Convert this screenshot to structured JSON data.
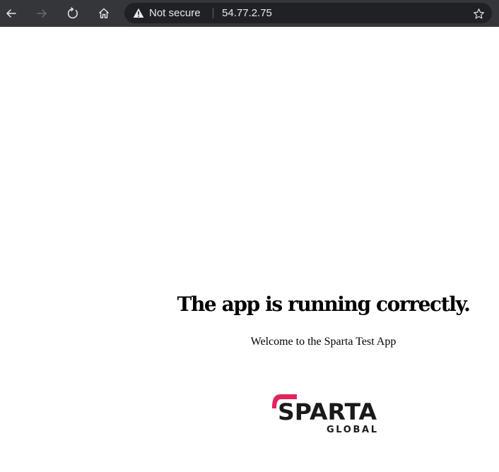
{
  "browser": {
    "security_label": "Not secure",
    "url": "54.77.2.75",
    "icons": {
      "back": "back-arrow-icon",
      "forward": "forward-arrow-icon",
      "reload": "reload-icon",
      "home": "home-icon",
      "warning": "warning-triangle-icon",
      "bookmark": "star-icon"
    }
  },
  "page": {
    "heading": "The app is running correctly.",
    "welcome": "Welcome to the Sparta Test App",
    "logo": {
      "line1": "SPARTA",
      "line2": "GLOBAL",
      "accent_color": "#e0245e",
      "text_color": "#1a1a1a"
    }
  },
  "colors": {
    "toolbar": "#35363a",
    "address_bar": "#202124",
    "toolbar_text": "#e8eaed",
    "page_background": "#ffffff"
  }
}
